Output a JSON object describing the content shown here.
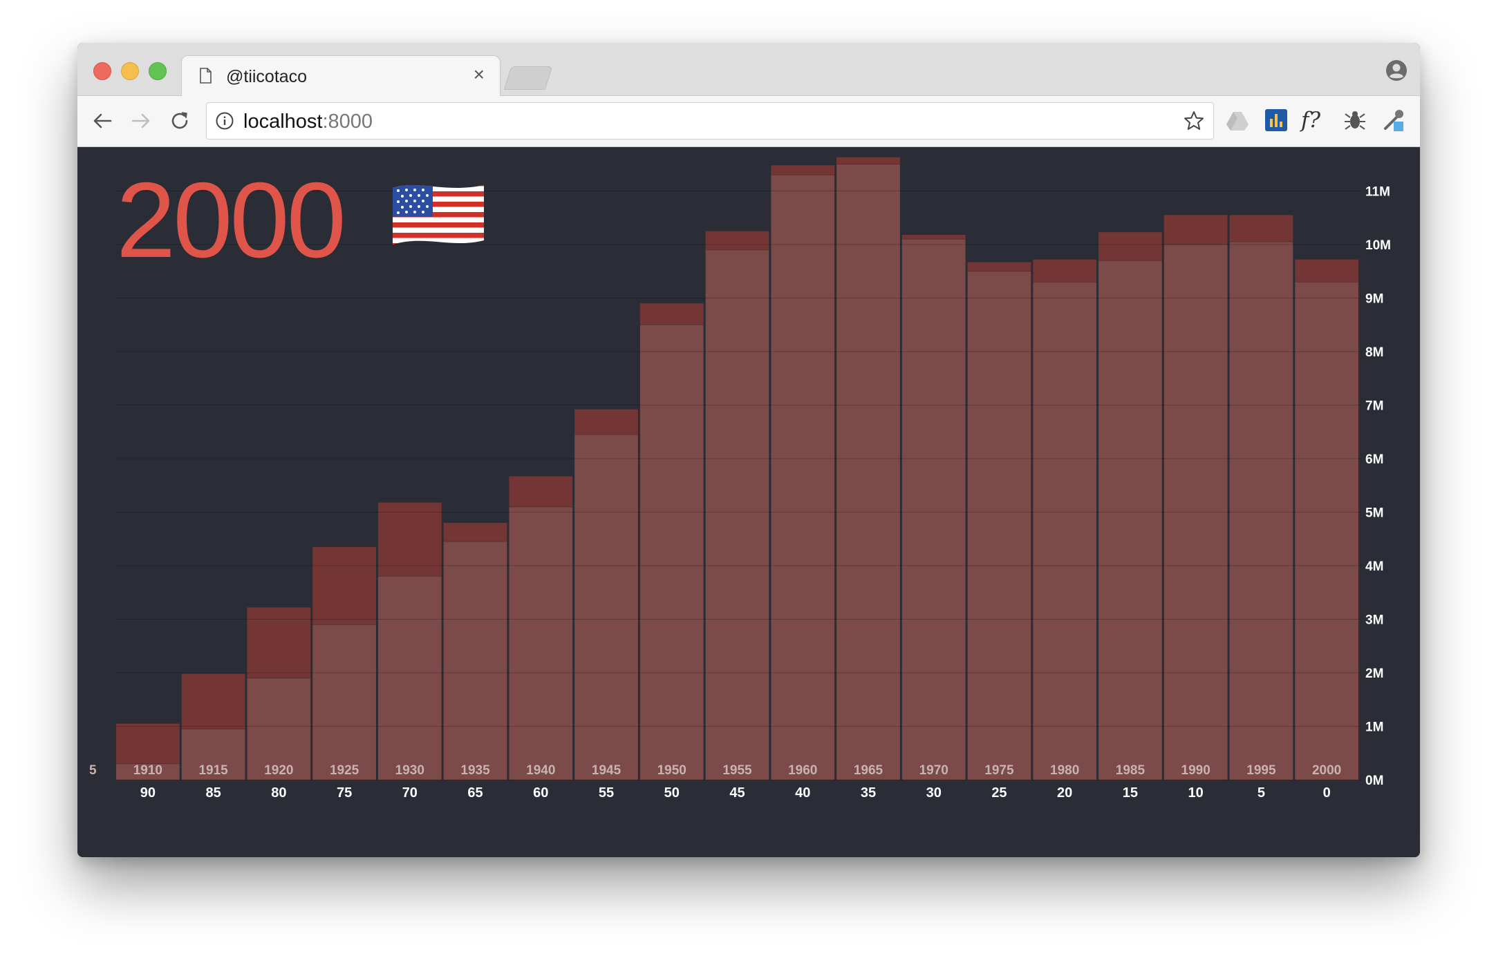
{
  "browser": {
    "tab_title": "@tiicotaco",
    "tab_close": "×",
    "url_host": "localhost",
    "url_port": ":8000",
    "extension_font_label": "f?"
  },
  "heading": {
    "year": "2000",
    "flag": "united-states-flag"
  },
  "colors": {
    "background": "#2a2d35",
    "heading": "#e0554a",
    "bar_current": "#7b4a49",
    "bar_historic_excess": "#743634",
    "bar_historic_deficit": "#2f3f48",
    "tick_text": "#ffffff",
    "birth_year_text": "#c9b3b1"
  },
  "chart_data": {
    "type": "bar",
    "title": "2000",
    "y_tick_labels": [
      "0M",
      "1M",
      "2M",
      "3M",
      "4M",
      "5M",
      "6M",
      "7M",
      "8M",
      "9M",
      "10M",
      "11M"
    ],
    "ylim": [
      0,
      11.7
    ],
    "y_unit": "millions",
    "partial_left_label": "5",
    "age_labels": [
      "90",
      "85",
      "80",
      "75",
      "70",
      "65",
      "60",
      "55",
      "50",
      "45",
      "40",
      "35",
      "30",
      "25",
      "20",
      "15",
      "10",
      "5",
      "0"
    ],
    "birth_year_labels": [
      "1910",
      "1915",
      "1920",
      "1925",
      "1930",
      "1935",
      "1940",
      "1945",
      "1950",
      "1955",
      "1960",
      "1965",
      "1970",
      "1975",
      "1980",
      "1985",
      "1990",
      "1995",
      "2000"
    ],
    "grid": true,
    "series": [
      {
        "values": [
          0.3,
          0.95,
          1.9,
          2.9,
          3.8,
          4.45,
          5.1,
          6.45,
          8.5,
          9.9,
          11.3,
          11.5,
          10.1,
          9.5,
          9.3,
          9.7,
          10.0,
          10.05,
          9.3
        ]
      },
      {
        "values": [
          1.05,
          1.98,
          3.22,
          4.35,
          5.18,
          4.8,
          5.67,
          6.92,
          8.9,
          10.25,
          11.48,
          11.63,
          10.18,
          9.67,
          9.72,
          10.23,
          10.55,
          10.55,
          9.72
        ]
      }
    ]
  }
}
